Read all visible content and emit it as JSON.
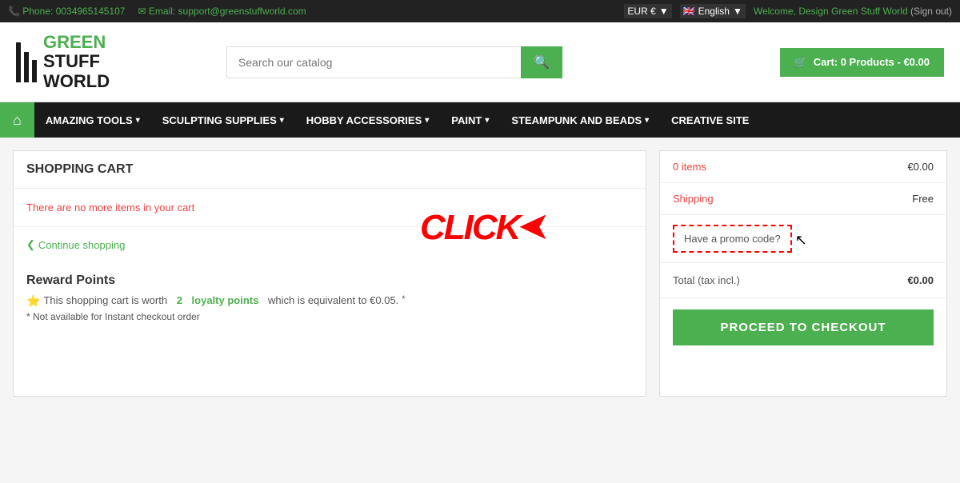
{
  "topbar": {
    "phone_label": "Phone:",
    "phone_number": "0034965145107",
    "email_label": "Email:",
    "email_address": "support@greenstuffworld.com",
    "currency": "EUR €",
    "currency_arrow": "▼",
    "language": "English",
    "language_arrow": "▼",
    "welcome_prefix": "Welcome,",
    "welcome_user": "Design Green Stuff World",
    "sign_out": "(Sign out)"
  },
  "header": {
    "logo_line1": "GREEN",
    "logo_line2": "STUFF",
    "logo_line3": "WORLD",
    "search_placeholder": "Search our catalog",
    "search_icon": "🔍",
    "cart_icon": "🛒",
    "cart_label": "Cart: 0 Products - €0.00"
  },
  "nav": {
    "home_icon": "⌂",
    "items": [
      {
        "label": "AMAZING TOOLS",
        "has_dropdown": true
      },
      {
        "label": "SCULPTING SUPPLIES",
        "has_dropdown": true
      },
      {
        "label": "HOBBY ACCESSORIES",
        "has_dropdown": true
      },
      {
        "label": "PAINT",
        "has_dropdown": true
      },
      {
        "label": "STEAMPUNK AND BEADS",
        "has_dropdown": true
      },
      {
        "label": "CREATIVE SITE",
        "has_dropdown": false
      }
    ]
  },
  "cart": {
    "title": "SHOPPING CART",
    "empty_message": "There are no more items in your cart",
    "continue_shopping": "Continue shopping",
    "continue_arrow": "❮"
  },
  "reward_points": {
    "title": "Reward Points",
    "star": "⭐",
    "text_prefix": "This shopping cart is worth",
    "points_value": "2",
    "points_label": "loyalty points",
    "text_suffix": "which is equivalent to €0.05.",
    "asterisk": "*",
    "note": "* Not available for Instant checkout order"
  },
  "order_summary": {
    "items_label": "0 items",
    "items_value": "€0.00",
    "shipping_label": "Shipping",
    "shipping_value": "Free",
    "promo_label": "Have a promo code?",
    "total_label": "Total (tax incl.)",
    "total_value": "€0.00",
    "checkout_label": "PROCEED TO CHECKOUT"
  },
  "click_annotation": {
    "text": "CLICK",
    "arrow": "◄"
  },
  "colors": {
    "green": "#4caf50",
    "red": "#e44",
    "dark": "#1a1a1a",
    "text_red": "red"
  }
}
